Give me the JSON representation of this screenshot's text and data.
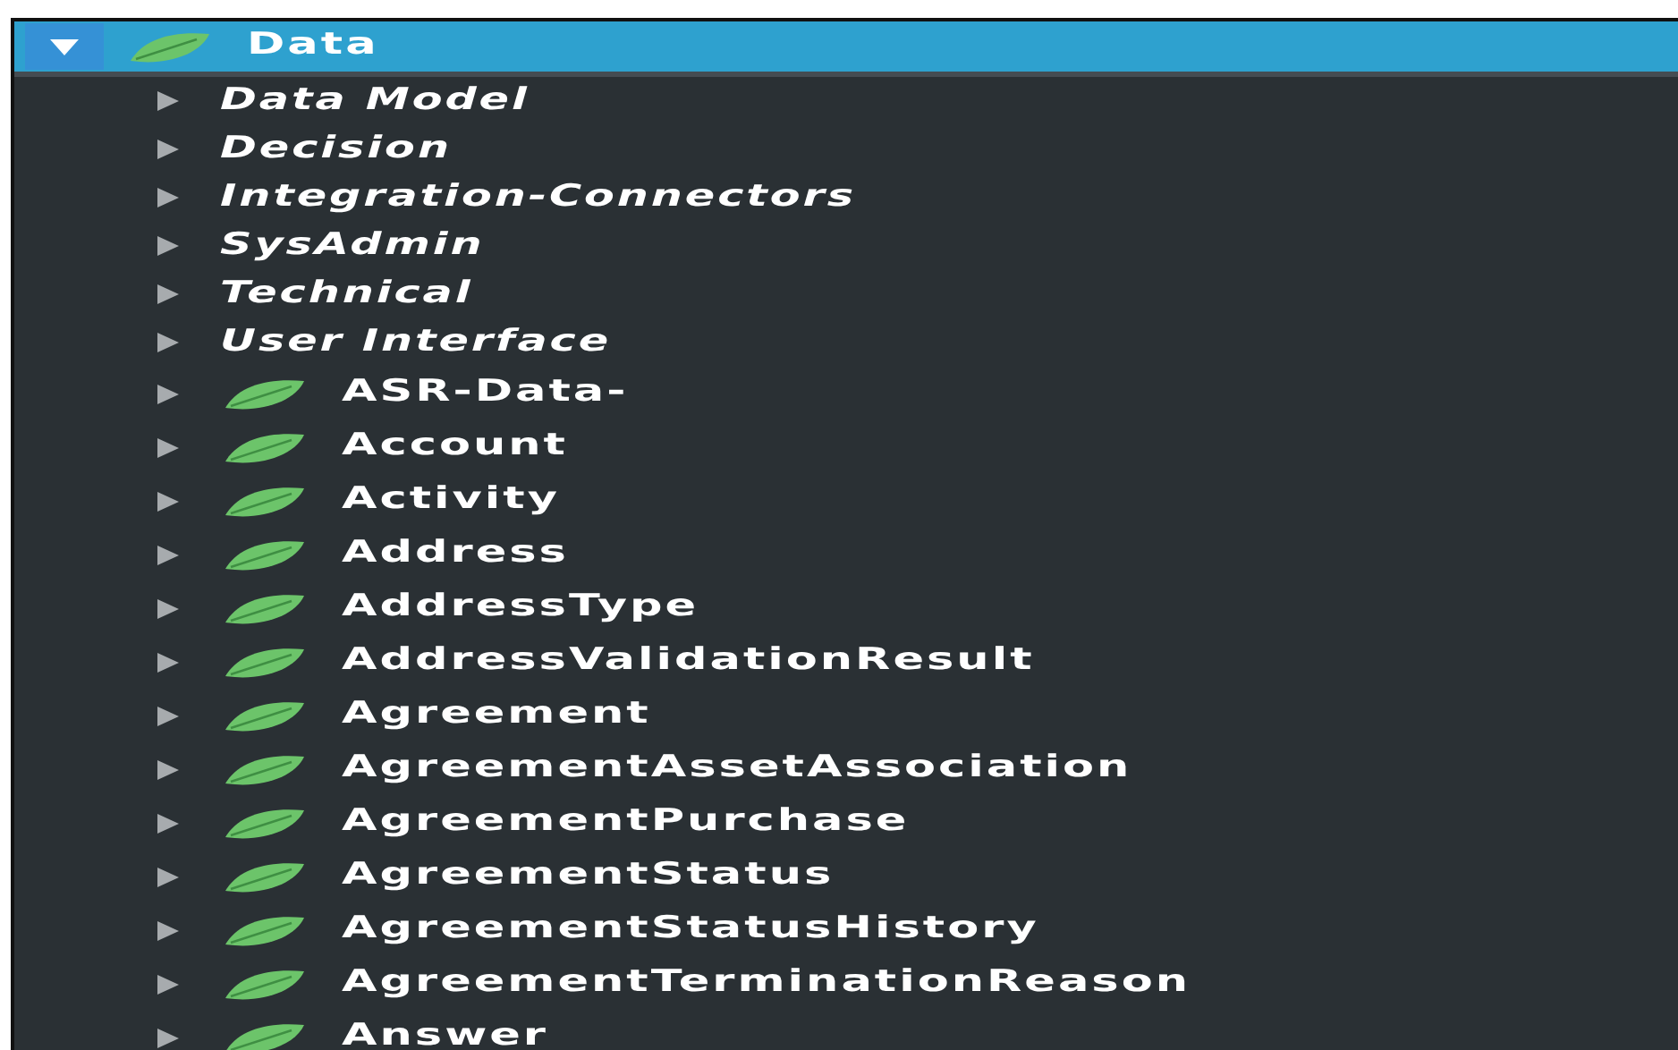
{
  "tree": {
    "label": "Data",
    "expanded": true,
    "children": [
      {
        "label": "Data Model",
        "kind": "folder",
        "expanded": false
      },
      {
        "label": "Decision",
        "kind": "folder",
        "expanded": false
      },
      {
        "label": "Integration-Connectors",
        "kind": "folder",
        "expanded": false
      },
      {
        "label": "SysAdmin",
        "kind": "folder",
        "expanded": false
      },
      {
        "label": "Technical",
        "kind": "folder",
        "expanded": false
      },
      {
        "label": "User Interface",
        "kind": "folder",
        "expanded": false
      },
      {
        "label": "ASR-Data-",
        "kind": "class",
        "expanded": false
      },
      {
        "label": "Account",
        "kind": "class",
        "expanded": false
      },
      {
        "label": "Activity",
        "kind": "class",
        "expanded": false
      },
      {
        "label": "Address",
        "kind": "class",
        "expanded": false
      },
      {
        "label": "AddressType",
        "kind": "class",
        "expanded": false
      },
      {
        "label": "AddressValidationResult",
        "kind": "class",
        "expanded": false
      },
      {
        "label": "Agreement",
        "kind": "class",
        "expanded": false
      },
      {
        "label": "AgreementAssetAssociation",
        "kind": "class",
        "expanded": false
      },
      {
        "label": "AgreementPurchase",
        "kind": "class",
        "expanded": false
      },
      {
        "label": "AgreementStatus",
        "kind": "class",
        "expanded": false
      },
      {
        "label": "AgreementStatusHistory",
        "kind": "class",
        "expanded": false
      },
      {
        "label": "AgreementTerminationReason",
        "kind": "class",
        "expanded": false
      },
      {
        "label": "Answer",
        "kind": "class",
        "expanded": false
      }
    ]
  }
}
